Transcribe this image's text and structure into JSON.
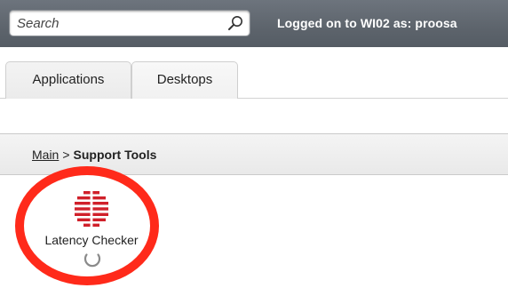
{
  "header": {
    "search": {
      "placeholder": "Search",
      "value": "",
      "icon": "search-icon"
    },
    "logon_text": "Logged on to WI02 as: proosa"
  },
  "tabs": [
    {
      "label": "Applications",
      "selected": true
    },
    {
      "label": "Desktops",
      "selected": false
    }
  ],
  "breadcrumb": {
    "root": "Main",
    "separator": ">",
    "current": "Support Tools"
  },
  "apps": [
    {
      "label": "Latency Checker",
      "icon": "latency-checker-icon",
      "loading": true
    }
  ],
  "colors": {
    "topbar": "#5f666e",
    "highlight": "#ff2a1a",
    "app_icon": "#d0202a"
  }
}
